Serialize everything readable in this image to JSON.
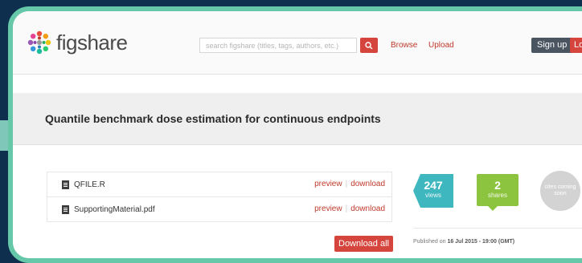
{
  "header": {
    "logo_text": "figshare",
    "search_placeholder": "search figshare (titles, tags, authors, etc.)",
    "nav": {
      "browse": "Browse",
      "upload": "Upload"
    },
    "signup": "Sign up",
    "login": "Lo"
  },
  "page_title": "Quantile benchmark dose estimation for continuous endpoints",
  "files": [
    {
      "name": "QFILE.R",
      "preview": "preview",
      "download": "download"
    },
    {
      "name": "SupportingMaterial.pdf",
      "preview": "preview",
      "download": "download"
    }
  ],
  "download_all": "Download all",
  "stats": {
    "views": {
      "value": "247",
      "label": "views"
    },
    "shares": {
      "value": "2",
      "label": "shares"
    },
    "cites": {
      "label": "cites coming soon"
    }
  },
  "published": {
    "prefix": "Published on",
    "date": "16 Jul 2015 - 19:00 (GMT)"
  },
  "colors": {
    "accent": "#d6453d",
    "teal": "#3fb7bf",
    "green": "#8cc43f",
    "frame": "#67c7a9"
  }
}
